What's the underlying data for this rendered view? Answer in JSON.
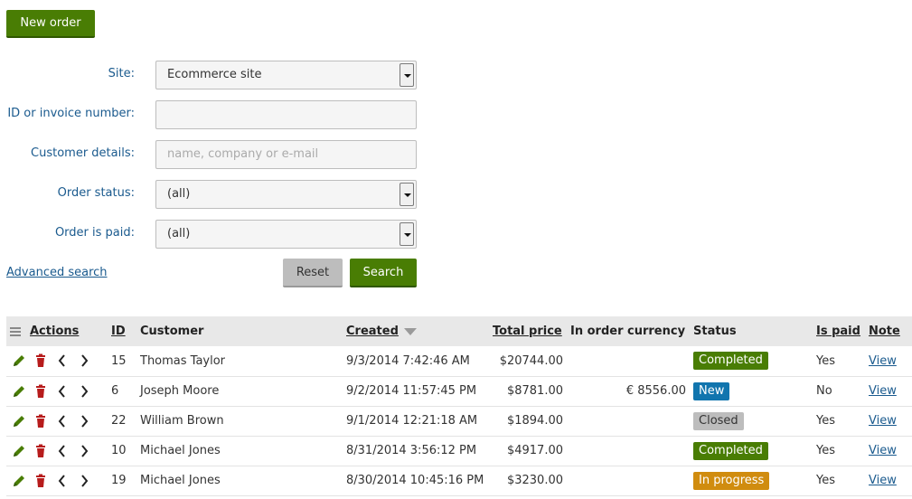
{
  "toolbar": {
    "new_order_label": "New order"
  },
  "filter": {
    "site_label": "Site:",
    "site_value": "Ecommerce site",
    "id_label": "ID or invoice number:",
    "id_value": "",
    "customer_label": "Customer details:",
    "customer_placeholder": "name, company or e-mail",
    "status_label": "Order status:",
    "status_value": "(all)",
    "paid_label": "Order is paid:",
    "paid_value": "(all)",
    "advanced_search": "Advanced search",
    "reset_label": "Reset",
    "search_label": "Search"
  },
  "table": {
    "headers": {
      "actions": "Actions",
      "id": "ID",
      "customer": "Customer",
      "created": "Created",
      "total_price": "Total price",
      "in_order_currency": "In order currency",
      "status": "Status",
      "is_paid": "Is paid",
      "note": "Note"
    },
    "rows": [
      {
        "id": "15",
        "customer": "Thomas Taylor",
        "created": "9/3/2014 7:42:46 AM",
        "total": "$20744.00",
        "currency": "",
        "status": "Completed",
        "status_color": "#497d04",
        "paid": "Yes",
        "note": "View"
      },
      {
        "id": "6",
        "customer": "Joseph Moore",
        "created": "9/2/2014 11:57:45 PM",
        "total": "$8781.00",
        "currency": "€ 8556.00",
        "status": "New",
        "status_color": "#1175ae",
        "paid": "No",
        "note": "View"
      },
      {
        "id": "22",
        "customer": "William Brown",
        "created": "9/1/2014 12:21:18 AM",
        "total": "$1894.00",
        "currency": "",
        "status": "Closed",
        "status_color": "#bdbdbd",
        "paid": "Yes",
        "note": "View"
      },
      {
        "id": "10",
        "customer": "Michael Jones",
        "created": "8/31/2014 3:56:12 PM",
        "total": "$4917.00",
        "currency": "",
        "status": "Completed",
        "status_color": "#497d04",
        "paid": "Yes",
        "note": "View"
      },
      {
        "id": "19",
        "customer": "Michael Jones",
        "created": "8/30/2014 10:45:16 PM",
        "total": "$3230.00",
        "currency": "",
        "status": "In progress",
        "status_color": "#d08c0f",
        "paid": "Yes",
        "note": "View"
      }
    ]
  },
  "colors": {
    "primary": "#497d04",
    "link": "#1a5a8e",
    "yes": "#3a9a1c",
    "no": "#c81d1d"
  },
  "icons": [
    "edit-icon",
    "delete-icon",
    "previous-icon",
    "next-icon",
    "menu-icon",
    "sort-descending-icon"
  ]
}
